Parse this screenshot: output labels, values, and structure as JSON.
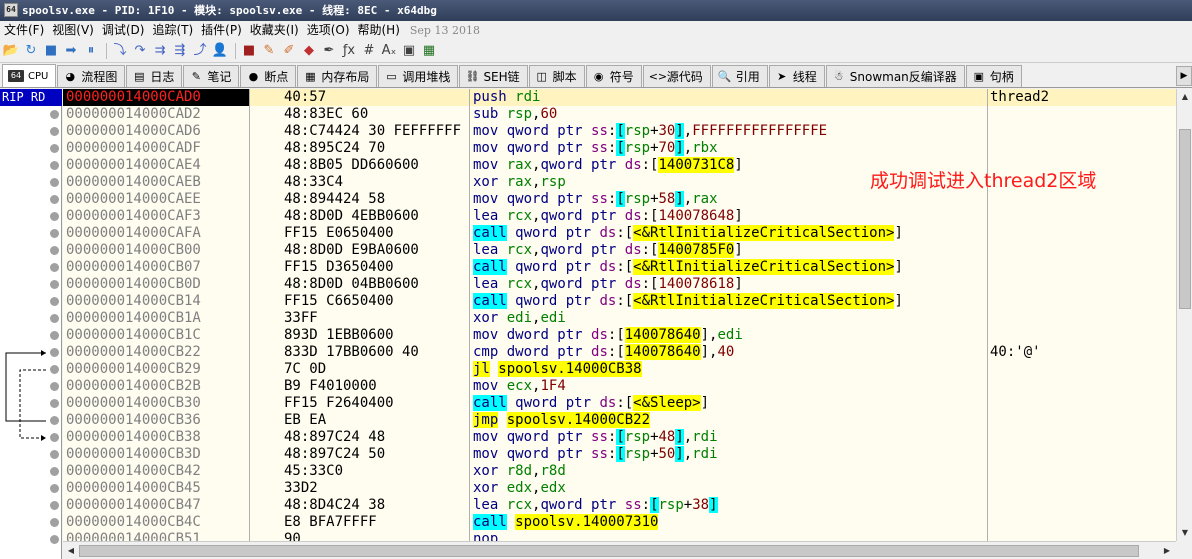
{
  "window": {
    "title": "spoolsv.exe - PID: 1F10 - 模块: spoolsv.exe - 线程: 8EC - x64dbg",
    "icon_text": "64"
  },
  "menu": {
    "items": [
      "文件(F)",
      "视图(V)",
      "调试(D)",
      "追踪(T)",
      "插件(P)",
      "收藏夹(I)",
      "选项(O)",
      "帮助(H)"
    ],
    "date": "Sep 13 2018"
  },
  "toolbar": {
    "icons": [
      "open-icon",
      "restart-icon",
      "stop-icon",
      "run-icon",
      "pause-icon",
      "step-into-icon",
      "step-over-icon",
      "trace-into-icon",
      "trace-over-icon",
      "execute-till-return-icon",
      "run-to-user-code-icon",
      "script-icon",
      "comment-icon",
      "label-icon",
      "bookmark-icon",
      "function-icon",
      "hash-icon",
      "strings-icon",
      "patch-icon",
      "calculator-icon",
      "globe-icon"
    ],
    "glyphs": [
      "📂",
      "↻",
      "■",
      "➡",
      "⏸",
      "⤵",
      "↷",
      "⇉",
      "⇶",
      "⤴",
      "👤",
      "■",
      "✎",
      "✐",
      "◆",
      "✒",
      "ƒx",
      "#",
      "Aₓ",
      "▣",
      "▦",
      "🌐"
    ]
  },
  "tabs": [
    {
      "label": "CPU",
      "glyph": "64",
      "active": true
    },
    {
      "label": "流程图",
      "glyph": "◕"
    },
    {
      "label": "日志",
      "glyph": "▤"
    },
    {
      "label": "笔记",
      "glyph": "✎"
    },
    {
      "label": "断点",
      "glyph": "●"
    },
    {
      "label": "内存布局",
      "glyph": "▦"
    },
    {
      "label": "调用堆栈",
      "glyph": "▭"
    },
    {
      "label": "SEH链",
      "glyph": "⛓"
    },
    {
      "label": "脚本",
      "glyph": "◫"
    },
    {
      "label": "符号",
      "glyph": "◉"
    },
    {
      "label": "源代码",
      "glyph": "<>"
    },
    {
      "label": "引用",
      "glyph": "🔍"
    },
    {
      "label": "线程",
      "glyph": "➤"
    },
    {
      "label": "Snowman反编译器",
      "glyph": "☃"
    },
    {
      "label": "句柄",
      "glyph": "▣"
    }
  ],
  "left_panel": {
    "rip_label": "RIP RD"
  },
  "annotation": "成功调试进入thread2区域",
  "rows": [
    {
      "addr": "000000014000CAD0",
      "bytes": "40:57",
      "jm": "",
      "dis": [
        [
          "mn",
          "push"
        ],
        [
          "t",
          " "
        ],
        [
          "rg",
          "rdi"
        ]
      ],
      "cmt": "thread2",
      "cur": true
    },
    {
      "addr": "000000014000CAD2",
      "bytes": "48:83EC 60",
      "jm": "",
      "dis": [
        [
          "mn",
          "sub"
        ],
        [
          "t",
          " "
        ],
        [
          "rg",
          "rsp"
        ],
        [
          "t",
          ","
        ],
        [
          "num",
          "60"
        ]
      ],
      "cmt": ""
    },
    {
      "addr": "000000014000CAD6",
      "bytes": "48:C74424 30 FEFFFFFF",
      "jm": "",
      "dis": [
        [
          "mn",
          "mov"
        ],
        [
          "t",
          " "
        ],
        [
          "pv",
          "qword ptr"
        ],
        [
          "t",
          " "
        ],
        [
          "sg",
          "ss"
        ],
        [
          "t",
          ":"
        ],
        [
          "brk",
          "["
        ],
        [
          "rg",
          "rsp"
        ],
        [
          "t",
          "+"
        ],
        [
          "num",
          "30"
        ],
        [
          "brk",
          "]"
        ],
        [
          "t",
          ","
        ],
        [
          "num",
          "FFFFFFFFFFFFFFFE"
        ]
      ],
      "cmt": ""
    },
    {
      "addr": "000000014000CADF",
      "bytes": "48:895C24 70",
      "jm": "",
      "dis": [
        [
          "mn",
          "mov"
        ],
        [
          "t",
          " "
        ],
        [
          "pv",
          "qword ptr"
        ],
        [
          "t",
          " "
        ],
        [
          "sg",
          "ss"
        ],
        [
          "t",
          ":"
        ],
        [
          "brk",
          "["
        ],
        [
          "rg",
          "rsp"
        ],
        [
          "t",
          "+"
        ],
        [
          "num",
          "70"
        ],
        [
          "brk",
          "]"
        ],
        [
          "t",
          ","
        ],
        [
          "rg",
          "rbx"
        ]
      ],
      "cmt": ""
    },
    {
      "addr": "000000014000CAE4",
      "bytes": "48:8B05 DD660600",
      "jm": "",
      "dis": [
        [
          "mn",
          "mov"
        ],
        [
          "t",
          " "
        ],
        [
          "rg",
          "rax"
        ],
        [
          "t",
          ","
        ],
        [
          "pv",
          "qword ptr"
        ],
        [
          "t",
          " "
        ],
        [
          "sg",
          "ds"
        ],
        [
          "t",
          ":["
        ],
        [
          "brv",
          "1400731C8"
        ],
        [
          "t",
          "]"
        ]
      ],
      "cmt": ""
    },
    {
      "addr": "000000014000CAEB",
      "bytes": "48:33C4",
      "jm": "",
      "dis": [
        [
          "mn",
          "xor"
        ],
        [
          "t",
          " "
        ],
        [
          "rg",
          "rax"
        ],
        [
          "t",
          ","
        ],
        [
          "rg",
          "rsp"
        ]
      ],
      "cmt": ""
    },
    {
      "addr": "000000014000CAEE",
      "bytes": "48:894424 58",
      "jm": "",
      "dis": [
        [
          "mn",
          "mov"
        ],
        [
          "t",
          " "
        ],
        [
          "pv",
          "qword ptr"
        ],
        [
          "t",
          " "
        ],
        [
          "sg",
          "ss"
        ],
        [
          "t",
          ":"
        ],
        [
          "brk",
          "["
        ],
        [
          "rg",
          "rsp"
        ],
        [
          "t",
          "+"
        ],
        [
          "num",
          "58"
        ],
        [
          "brk",
          "]"
        ],
        [
          "t",
          ","
        ],
        [
          "rg",
          "rax"
        ]
      ],
      "cmt": ""
    },
    {
      "addr": "000000014000CAF3",
      "bytes": "48:8D0D 4EBB0600",
      "jm": "",
      "dis": [
        [
          "mn",
          "lea"
        ],
        [
          "t",
          " "
        ],
        [
          "rg",
          "rcx"
        ],
        [
          "t",
          ","
        ],
        [
          "pv",
          "qword ptr"
        ],
        [
          "t",
          " "
        ],
        [
          "sg",
          "ds"
        ],
        [
          "t",
          ":["
        ],
        [
          "num",
          "140078648"
        ],
        [
          "t",
          "]"
        ]
      ],
      "cmt": ""
    },
    {
      "addr": "000000014000CAFA",
      "bytes": "FF15 E0650400",
      "jm": "",
      "dis": [
        [
          "cal",
          "call"
        ],
        [
          "t",
          " "
        ],
        [
          "pv",
          "qword ptr"
        ],
        [
          "t",
          " "
        ],
        [
          "sg",
          "ds"
        ],
        [
          "t",
          ":["
        ],
        [
          "brv",
          "<&RtlInitializeCriticalSection>"
        ],
        [
          "t",
          "]"
        ]
      ],
      "cmt": ""
    },
    {
      "addr": "000000014000CB00",
      "bytes": "48:8D0D E9BA0600",
      "jm": "",
      "dis": [
        [
          "mn",
          "lea"
        ],
        [
          "t",
          " "
        ],
        [
          "rg",
          "rcx"
        ],
        [
          "t",
          ","
        ],
        [
          "pv",
          "qword ptr"
        ],
        [
          "t",
          " "
        ],
        [
          "sg",
          "ds"
        ],
        [
          "t",
          ":["
        ],
        [
          "brv",
          "1400785F0"
        ],
        [
          "t",
          "]"
        ]
      ],
      "cmt": ""
    },
    {
      "addr": "000000014000CB07",
      "bytes": "FF15 D3650400",
      "jm": "",
      "dis": [
        [
          "cal",
          "call"
        ],
        [
          "t",
          " "
        ],
        [
          "pv",
          "qword ptr"
        ],
        [
          "t",
          " "
        ],
        [
          "sg",
          "ds"
        ],
        [
          "t",
          ":["
        ],
        [
          "brv",
          "<&RtlInitializeCriticalSection>"
        ],
        [
          "t",
          "]"
        ]
      ],
      "cmt": ""
    },
    {
      "addr": "000000014000CB0D",
      "bytes": "48:8D0D 04BB0600",
      "jm": "",
      "dis": [
        [
          "mn",
          "lea"
        ],
        [
          "t",
          " "
        ],
        [
          "rg",
          "rcx"
        ],
        [
          "t",
          ","
        ],
        [
          "pv",
          "qword ptr"
        ],
        [
          "t",
          " "
        ],
        [
          "sg",
          "ds"
        ],
        [
          "t",
          ":["
        ],
        [
          "num",
          "140078618"
        ],
        [
          "t",
          "]"
        ]
      ],
      "cmt": ""
    },
    {
      "addr": "000000014000CB14",
      "bytes": "FF15 C6650400",
      "jm": "",
      "dis": [
        [
          "cal",
          "call"
        ],
        [
          "t",
          " "
        ],
        [
          "pv",
          "qword ptr"
        ],
        [
          "t",
          " "
        ],
        [
          "sg",
          "ds"
        ],
        [
          "t",
          ":["
        ],
        [
          "brv",
          "<&RtlInitializeCriticalSection>"
        ],
        [
          "t",
          "]"
        ]
      ],
      "cmt": ""
    },
    {
      "addr": "000000014000CB1A",
      "bytes": "33FF",
      "jm": "",
      "dis": [
        [
          "mn",
          "xor"
        ],
        [
          "t",
          " "
        ],
        [
          "rg",
          "edi"
        ],
        [
          "t",
          ","
        ],
        [
          "rg",
          "edi"
        ]
      ],
      "cmt": ""
    },
    {
      "addr": "000000014000CB1C",
      "bytes": "893D 1EBB0600",
      "jm": "",
      "dis": [
        [
          "mn",
          "mov"
        ],
        [
          "t",
          " "
        ],
        [
          "pv",
          "dword ptr"
        ],
        [
          "t",
          " "
        ],
        [
          "sg",
          "ds"
        ],
        [
          "t",
          ":["
        ],
        [
          "brv",
          "140078640"
        ],
        [
          "t",
          "],"
        ],
        [
          "rg",
          "edi"
        ]
      ],
      "cmt": ""
    },
    {
      "addr": "000000014000CB22",
      "bytes": "833D 17BB0600 40",
      "jm": "",
      "dis": [
        [
          "mn",
          "cmp"
        ],
        [
          "t",
          " "
        ],
        [
          "pv",
          "dword ptr"
        ],
        [
          "t",
          " "
        ],
        [
          "sg",
          "ds"
        ],
        [
          "t",
          ":["
        ],
        [
          "brv",
          "140078640"
        ],
        [
          "t",
          "],"
        ],
        [
          "num",
          "40"
        ]
      ],
      "cmt": "40:'@'"
    },
    {
      "addr": "000000014000CB29",
      "bytes": "7C 0D",
      "jm": "˅",
      "dis": [
        [
          "jmp",
          "jl"
        ],
        [
          "t",
          " "
        ],
        [
          "brv",
          "spoolsv.14000CB38"
        ]
      ],
      "cmt": ""
    },
    {
      "addr": "000000014000CB2B",
      "bytes": "B9 F4010000",
      "jm": "",
      "dis": [
        [
          "mn",
          "mov"
        ],
        [
          "t",
          " "
        ],
        [
          "rg",
          "ecx"
        ],
        [
          "t",
          ","
        ],
        [
          "num",
          "1F4"
        ]
      ],
      "cmt": ""
    },
    {
      "addr": "000000014000CB30",
      "bytes": "FF15 F2640400",
      "jm": "",
      "dis": [
        [
          "cal",
          "call"
        ],
        [
          "t",
          " "
        ],
        [
          "pv",
          "qword ptr"
        ],
        [
          "t",
          " "
        ],
        [
          "sg",
          "ds"
        ],
        [
          "t",
          ":["
        ],
        [
          "brv",
          "<&Sleep>"
        ],
        [
          "t",
          "]"
        ]
      ],
      "cmt": ""
    },
    {
      "addr": "000000014000CB36",
      "bytes": "EB EA",
      "jm": "˄",
      "dis": [
        [
          "jmp",
          "jmp"
        ],
        [
          "t",
          " "
        ],
        [
          "brv",
          "spoolsv.14000CB22"
        ]
      ],
      "cmt": ""
    },
    {
      "addr": "000000014000CB38",
      "bytes": "48:897C24 48",
      "jm": "",
      "dis": [
        [
          "mn",
          "mov"
        ],
        [
          "t",
          " "
        ],
        [
          "pv",
          "qword ptr"
        ],
        [
          "t",
          " "
        ],
        [
          "sg",
          "ss"
        ],
        [
          "t",
          ":"
        ],
        [
          "brk",
          "["
        ],
        [
          "rg",
          "rsp"
        ],
        [
          "t",
          "+"
        ],
        [
          "num",
          "48"
        ],
        [
          "brk",
          "]"
        ],
        [
          "t",
          ","
        ],
        [
          "rg",
          "rdi"
        ]
      ],
      "cmt": ""
    },
    {
      "addr": "000000014000CB3D",
      "bytes": "48:897C24 50",
      "jm": "",
      "dis": [
        [
          "mn",
          "mov"
        ],
        [
          "t",
          " "
        ],
        [
          "pv",
          "qword ptr"
        ],
        [
          "t",
          " "
        ],
        [
          "sg",
          "ss"
        ],
        [
          "t",
          ":"
        ],
        [
          "brk",
          "["
        ],
        [
          "rg",
          "rsp"
        ],
        [
          "t",
          "+"
        ],
        [
          "num",
          "50"
        ],
        [
          "brk",
          "]"
        ],
        [
          "t",
          ","
        ],
        [
          "rg",
          "rdi"
        ]
      ],
      "cmt": ""
    },
    {
      "addr": "000000014000CB42",
      "bytes": "45:33C0",
      "jm": "",
      "dis": [
        [
          "mn",
          "xor"
        ],
        [
          "t",
          " "
        ],
        [
          "rg",
          "r8d"
        ],
        [
          "t",
          ","
        ],
        [
          "rg",
          "r8d"
        ]
      ],
      "cmt": ""
    },
    {
      "addr": "000000014000CB45",
      "bytes": "33D2",
      "jm": "",
      "dis": [
        [
          "mn",
          "xor"
        ],
        [
          "t",
          " "
        ],
        [
          "rg",
          "edx"
        ],
        [
          "t",
          ","
        ],
        [
          "rg",
          "edx"
        ]
      ],
      "cmt": ""
    },
    {
      "addr": "000000014000CB47",
      "bytes": "48:8D4C24 38",
      "jm": "",
      "dis": [
        [
          "mn",
          "lea"
        ],
        [
          "t",
          " "
        ],
        [
          "rg",
          "rcx"
        ],
        [
          "t",
          ","
        ],
        [
          "pv",
          "qword ptr"
        ],
        [
          "t",
          " "
        ],
        [
          "sg",
          "ss"
        ],
        [
          "t",
          ":"
        ],
        [
          "brk",
          "["
        ],
        [
          "rg",
          "rsp"
        ],
        [
          "t",
          "+"
        ],
        [
          "num",
          "38"
        ],
        [
          "brk",
          "]"
        ]
      ],
      "cmt": ""
    },
    {
      "addr": "000000014000CB4C",
      "bytes": "E8 BFA7FFFF",
      "jm": "",
      "dis": [
        [
          "cal",
          "call"
        ],
        [
          "t",
          " "
        ],
        [
          "brv",
          "spoolsv.140007310"
        ]
      ],
      "cmt": ""
    },
    {
      "addr": "000000014000CB51",
      "bytes": "90",
      "jm": "",
      "dis": [
        [
          "mn",
          "nop"
        ]
      ],
      "cmt": ""
    }
  ]
}
